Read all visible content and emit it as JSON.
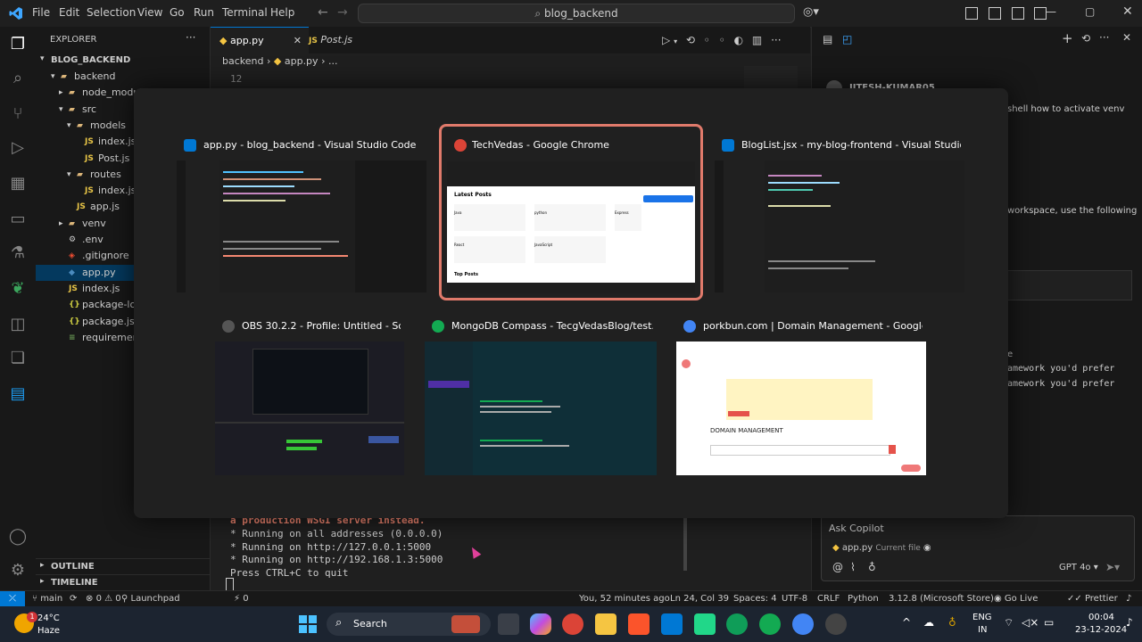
{
  "menu": [
    "File",
    "Edit",
    "Selection",
    "View",
    "Go",
    "Run",
    "Terminal",
    "Help"
  ],
  "search": {
    "label": "blog_backend"
  },
  "sidebar": {
    "header": "EXPLORER",
    "project": "BLOG_BACKEND",
    "items": [
      {
        "label": "backend",
        "indent": 1,
        "kind": "folder-open"
      },
      {
        "label": "node_modules",
        "indent": 2,
        "kind": "folder"
      },
      {
        "label": "src",
        "indent": 2,
        "kind": "folder-open"
      },
      {
        "label": "models",
        "indent": 3,
        "kind": "folder-open"
      },
      {
        "label": "index.js",
        "indent": 4,
        "kind": "js"
      },
      {
        "label": "Post.js",
        "indent": 4,
        "kind": "js"
      },
      {
        "label": "routes",
        "indent": 3,
        "kind": "folder-open"
      },
      {
        "label": "index.js",
        "indent": 4,
        "kind": "js"
      },
      {
        "label": "app.js",
        "indent": 3,
        "kind": "js"
      },
      {
        "label": "venv",
        "indent": 2,
        "kind": "folder"
      },
      {
        "label": ".env",
        "indent": 2,
        "kind": "env"
      },
      {
        "label": ".gitignore",
        "indent": 2,
        "kind": "git"
      },
      {
        "label": "app.py",
        "indent": 2,
        "kind": "py"
      },
      {
        "label": "index.js",
        "indent": 2,
        "kind": "js"
      },
      {
        "label": "package-lock.json",
        "indent": 2,
        "kind": "json"
      },
      {
        "label": "package.json",
        "indent": 2,
        "kind": "json"
      },
      {
        "label": "requirements.txt",
        "indent": 2,
        "kind": "txt"
      }
    ],
    "outline": "OUTLINE",
    "timeline": "TIMELINE"
  },
  "tabs": [
    {
      "label": "app.py",
      "active": true
    },
    {
      "label": "Post.js",
      "active": false
    }
  ],
  "breadcrumb": {
    "folder": "backend",
    "file": "app.py",
    "rest": "..."
  },
  "editor": {
    "line_number": "12"
  },
  "terminal": {
    "lines": [
      "a production WSGI server instead.",
      " * Running on all addresses (0.0.0.0)",
      " * Running on http://127.0.0.1:5000",
      " * Running on http://192.168.1.3:5000",
      "Press CTRL+C to quit"
    ]
  },
  "chat": {
    "user": "JITESH-KUMAR05",
    "snippet1": "shell how to activate venv",
    "snippet2": "workspace, use the following",
    "snippet3": "e",
    "snippet4": "amework you'd prefer",
    "snippet5": "amework you'd prefer",
    "ask_placeholder": "Ask Copilot",
    "context_file": "app.py",
    "context_label": "Current file",
    "model": "GPT 4o"
  },
  "switcher": {
    "windows": [
      {
        "title": "app.py - blog_backend - Visual Studio Code",
        "app": "vscode",
        "selected": false
      },
      {
        "title": "TechVedas - Google Chrome",
        "app": "chrome",
        "selected": true
      },
      {
        "title": "BlogList.jsx - my-blog-frontend - Visual Studio Code",
        "app": "vscode",
        "selected": false
      },
      {
        "title": "OBS 30.2.2 - Profile: Untitled - Scene...",
        "app": "obs",
        "selected": false
      },
      {
        "title": "MongoDB Compass - TecgVedasBlog/test.posts",
        "app": "mongodb",
        "selected": false
      },
      {
        "title": "porkbun.com | Domain Management - Google Chro...",
        "app": "chrome",
        "selected": false
      }
    ],
    "chrome_thumb": {
      "heading": "Latest Posts",
      "sub": "Top Posts",
      "cards": [
        "Java",
        "python",
        "Express",
        "React",
        "JavaScript"
      ]
    },
    "porkbun_thumb": {
      "heading": "DOMAIN MANAGEMENT"
    }
  },
  "statusbar": {
    "branch": "main",
    "launchpad": "Launchpad",
    "errors": "0",
    "warnings": "0",
    "ports": "0",
    "blame": "You, 52 minutes ago",
    "position": "Ln 24, Col 39",
    "spaces": "Spaces: 4",
    "encoding": "UTF-8",
    "eol": "CRLF",
    "language": "Python",
    "interpreter": "3.12.8 (Microsoft Store)",
    "golive": "Go Live",
    "prettier": "Prettier"
  },
  "taskbar": {
    "weather_temp": "24°C",
    "weather_desc": "Haze",
    "badge": "1",
    "search": "Search",
    "lang1": "ENG",
    "lang2": "IN",
    "time": "00:04",
    "date": "23-12-2024"
  },
  "colors": {
    "accent": "#0078d4",
    "selected_border": "#e07a6b",
    "statusbar": "#181818",
    "taskbar": "#1c2430"
  }
}
